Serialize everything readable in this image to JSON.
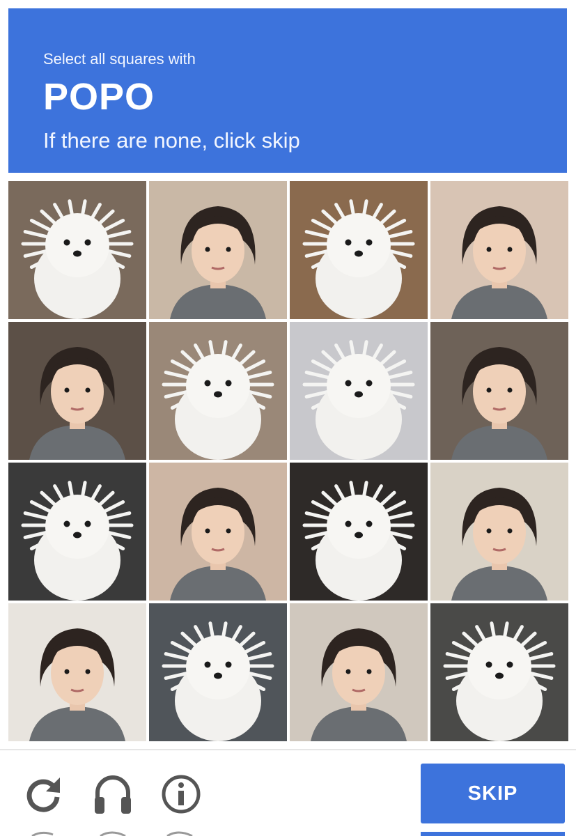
{
  "header": {
    "prompt": "Select all squares with",
    "target": "POPO",
    "subtext": "If there are none, click skip",
    "color": "#3d73dc"
  },
  "tiles": [
    {
      "row": 1,
      "col": 1,
      "subject": "dog"
    },
    {
      "row": 1,
      "col": 2,
      "subject": "person"
    },
    {
      "row": 1,
      "col": 3,
      "subject": "dog"
    },
    {
      "row": 1,
      "col": 4,
      "subject": "person"
    },
    {
      "row": 2,
      "col": 1,
      "subject": "person"
    },
    {
      "row": 2,
      "col": 2,
      "subject": "dog"
    },
    {
      "row": 2,
      "col": 3,
      "subject": "dog"
    },
    {
      "row": 2,
      "col": 4,
      "subject": "person"
    },
    {
      "row": 3,
      "col": 1,
      "subject": "dog"
    },
    {
      "row": 3,
      "col": 2,
      "subject": "person"
    },
    {
      "row": 3,
      "col": 3,
      "subject": "dog"
    },
    {
      "row": 3,
      "col": 4,
      "subject": "person"
    },
    {
      "row": 4,
      "col": 1,
      "subject": "person"
    },
    {
      "row": 4,
      "col": 2,
      "subject": "dog"
    },
    {
      "row": 4,
      "col": 3,
      "subject": "person"
    },
    {
      "row": 4,
      "col": 4,
      "subject": "dog"
    }
  ],
  "footer": {
    "icons": [
      "reload-icon",
      "audio-icon",
      "info-icon"
    ],
    "skip_label": "SKIP",
    "button_color": "#3d73dc"
  }
}
